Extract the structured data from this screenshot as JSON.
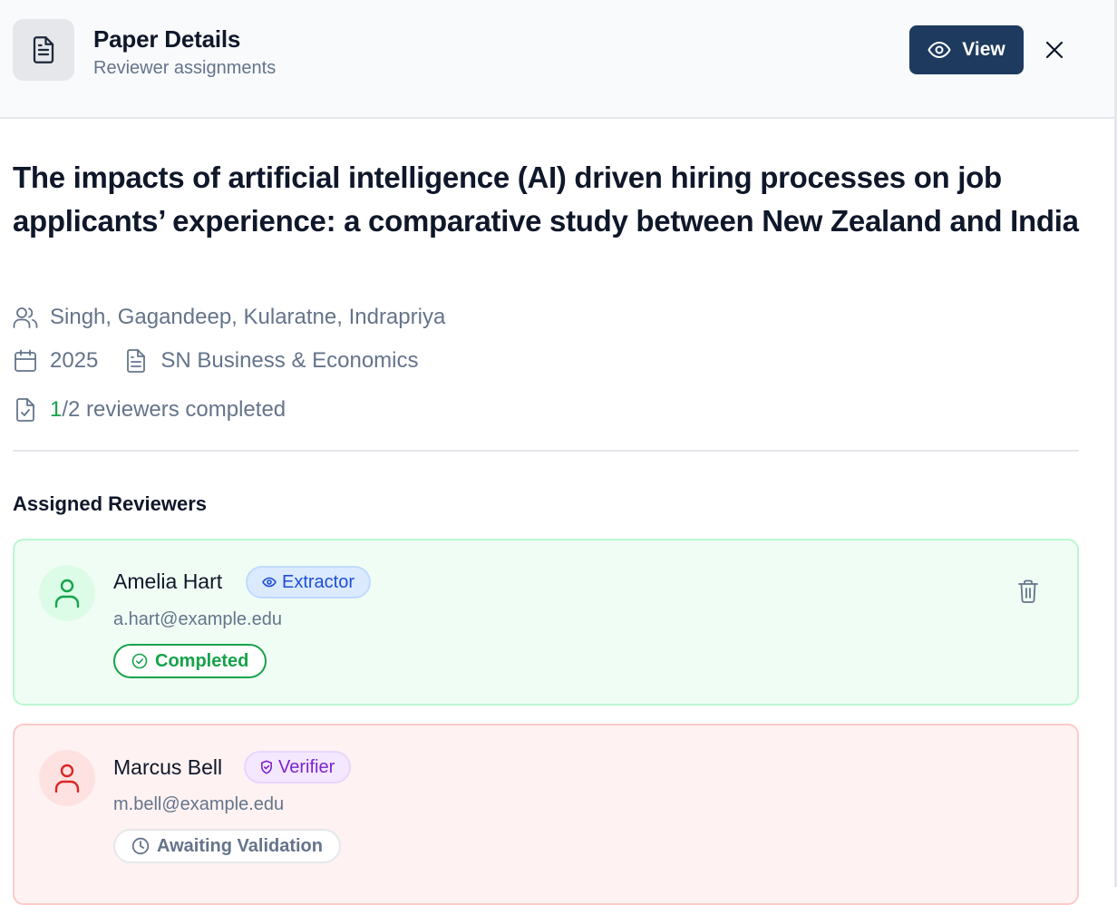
{
  "header": {
    "title": "Paper Details",
    "subtitle": "Reviewer assignments",
    "view_label": "View",
    "icon": "file-text-icon"
  },
  "paper": {
    "title": "The impacts of artificial intelligence (AI) driven hiring processes on job applicants’ experience: a comparative study between New Zealand and India",
    "authors": "Singh, Gagandeep, Kularatne, Indrapriya",
    "year": "2025",
    "journal": "SN Business & Economics",
    "progress": {
      "completed": "1",
      "rest": "/2 reviewers completed"
    }
  },
  "reviewers_section": {
    "title": "Assigned Reviewers",
    "reviewers": [
      {
        "name": "Amelia Hart",
        "role": "Extractor",
        "email": "a.hart@example.edu",
        "status": "Completed",
        "accent": "#16a34a"
      },
      {
        "name": "Marcus Bell",
        "role": "Verifier",
        "email": "m.bell@example.edu",
        "status": "Awaiting Validation",
        "accent": "#dc2626"
      }
    ]
  },
  "colors": {
    "primary_button": "#1e3a5f",
    "completed_green": "#16a34a",
    "extractor_blue": "#1d4ed8",
    "verifier_purple": "#7e22ce"
  }
}
